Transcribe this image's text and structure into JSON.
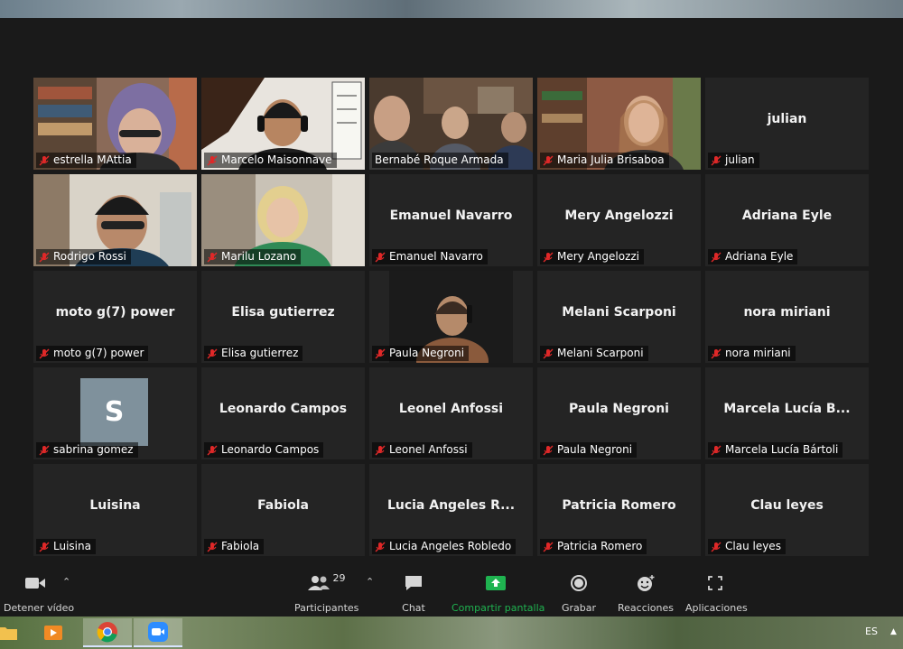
{
  "participants": [
    {
      "name": "estrella MAttia",
      "display": "video"
    },
    {
      "name": "Marcelo Maisonnave",
      "display": "video"
    },
    {
      "name": "Bernabé Roque Armada",
      "display": "video",
      "active_speaker": true
    },
    {
      "name": "Maria Julia Brisaboa",
      "display": "video"
    },
    {
      "name": "julian",
      "display": "name",
      "center_name": "julian"
    },
    {
      "name": "Rodrigo Rossi",
      "display": "video"
    },
    {
      "name": "Marilu Lozano",
      "display": "video"
    },
    {
      "name": "Emanuel Navarro",
      "display": "name",
      "center_name": "Emanuel Navarro"
    },
    {
      "name": "Mery Angelozzi",
      "display": "name",
      "center_name": "Mery Angelozzi"
    },
    {
      "name": "Adriana Eyle",
      "display": "name",
      "center_name": "Adriana Eyle"
    },
    {
      "name": "moto g(7) power",
      "display": "name",
      "center_name": "moto g(7) power"
    },
    {
      "name": "Elisa gutierrez",
      "display": "name",
      "center_name": "Elisa gutierrez"
    },
    {
      "name": "Paula Negroni",
      "display": "video"
    },
    {
      "name": "Melani Scarponi",
      "display": "name",
      "center_name": "Melani Scarponi"
    },
    {
      "name": "nora miriani",
      "display": "name",
      "center_name": "nora miriani"
    },
    {
      "name": "sabrina gomez",
      "display": "avatar",
      "avatar_letter": "S"
    },
    {
      "name": "Leonardo Campos",
      "display": "name",
      "center_name": "Leonardo Campos"
    },
    {
      "name": "Leonel Anfossi",
      "display": "name",
      "center_name": "Leonel Anfossi"
    },
    {
      "name": "Paula Negroni",
      "display": "name",
      "center_name": "Paula Negroni"
    },
    {
      "name": "Marcela Lucía Bártoli",
      "display": "name",
      "center_name": "Marcela Lucía B..."
    },
    {
      "name": "Luisina",
      "display": "name",
      "center_name": "Luisina"
    },
    {
      "name": "Fabiola",
      "display": "name",
      "center_name": "Fabiola"
    },
    {
      "name": "Lucia Angeles Robledo",
      "display": "name",
      "center_name": "Lucia Angeles R..."
    },
    {
      "name": "Patricia Romero",
      "display": "name",
      "center_name": "Patricia Romero"
    },
    {
      "name": "Clau leyes",
      "display": "name",
      "center_name": "Clau leyes"
    }
  ],
  "toolbar": {
    "stop_video": "Detener vídeo",
    "participants": "Participantes",
    "participants_count": "29",
    "chat": "Chat",
    "share_screen": "Compartir pantalla",
    "record": "Grabar",
    "reactions": "Reacciones",
    "apps": "Aplicaciones"
  },
  "taskbar": {
    "language": "ES",
    "apps": [
      "file-explorer-icon",
      "media-player-icon",
      "chrome-icon",
      "zoom-icon"
    ]
  },
  "colors": {
    "active_speaker_border": "#c8dc57",
    "share_screen_green": "#1fb350",
    "muted_red": "#e02828",
    "tile_bg": "#242424"
  }
}
